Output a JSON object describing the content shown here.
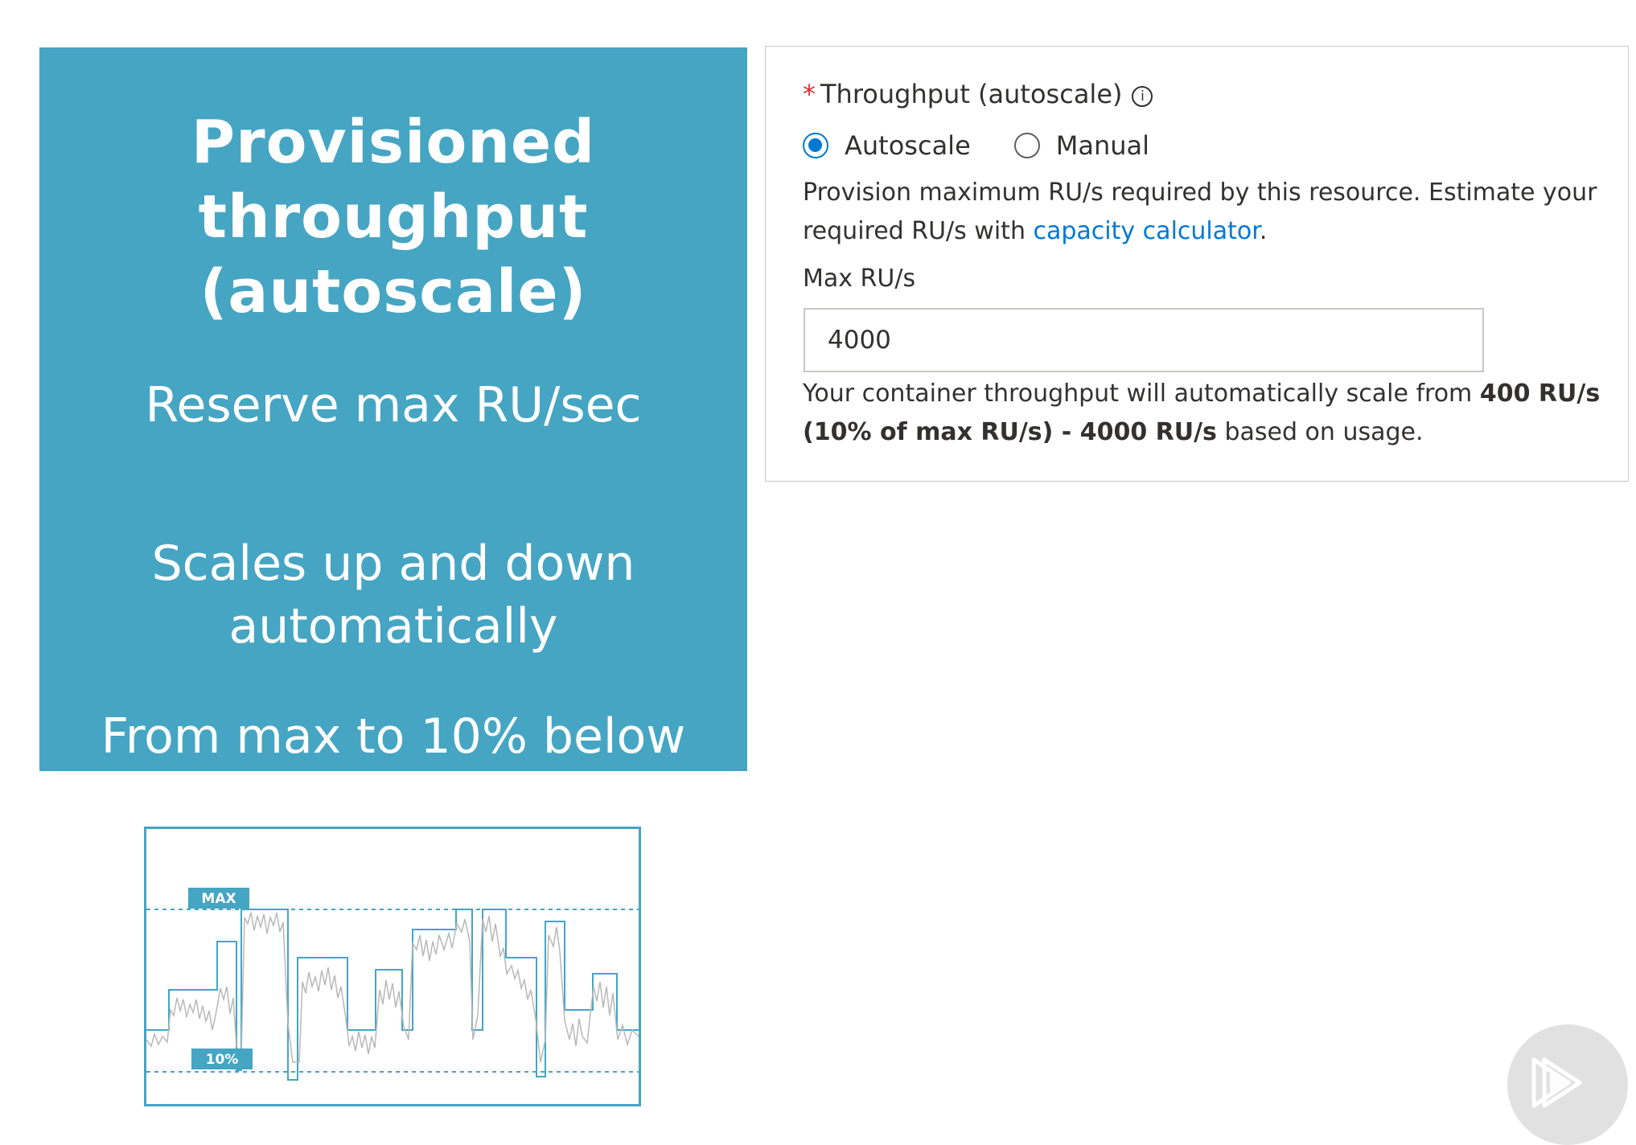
{
  "slide": {
    "title_lines": [
      "Provisioned",
      "throughput",
      "(autoscale)"
    ],
    "points": [
      [
        "Reserve max RU/sec"
      ],
      [
        "Scales up and down",
        "automatically"
      ],
      [
        "From max to 10% below"
      ]
    ],
    "background_color": "#45a5c3"
  },
  "illustration": {
    "max_label": "MAX",
    "min_label": "10%",
    "accent_color": "#45a5c3"
  },
  "form": {
    "required_marker": "*",
    "throughput_label": "Throughput (autoscale)",
    "info_icon": "info-icon",
    "info_glyph": "i",
    "radio_options": [
      {
        "label": "Autoscale",
        "checked": true
      },
      {
        "label": "Manual",
        "checked": false
      }
    ],
    "description_prefix": "Provision maximum RU/s required by this resource. Estimate your required RU/s with ",
    "calculator_link": "capacity calculator",
    "description_suffix": ".",
    "max_label": "Max RU/s",
    "max_value": "4000",
    "note_prefix": "Your container throughput will automatically scale from ",
    "note_range": "400 RU/s (10% of max RU/s) - 4000 RU/s",
    "note_suffix": " based on usage.",
    "link_color": "#0078d4",
    "required_color": "#d13438"
  },
  "player": {
    "icon": "play-icon"
  }
}
